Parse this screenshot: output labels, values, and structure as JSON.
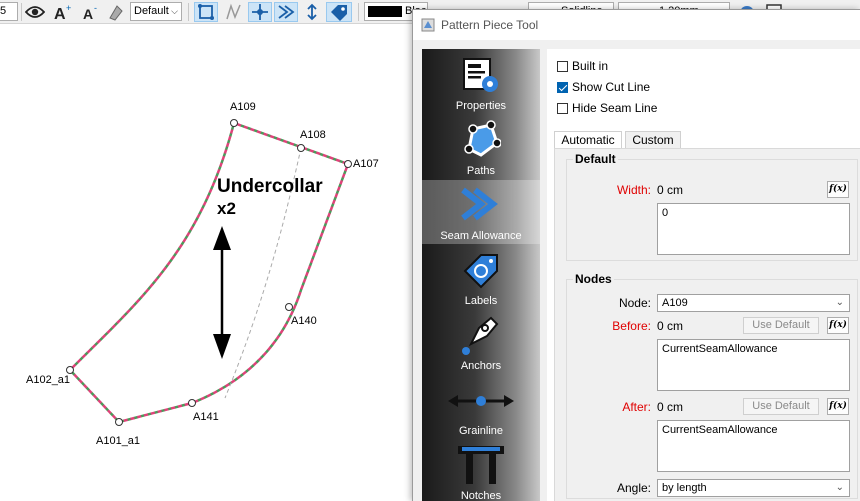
{
  "toolbar": {
    "size_value": "5",
    "line_type_value": "Default",
    "color_value": "Black",
    "pen_style_value": "Solidline",
    "line_weight_value": "1.20mm"
  },
  "canvas": {
    "piece_title": "Undercollar",
    "piece_count": "x2",
    "point_labels": [
      "A109",
      "A108",
      "A107",
      "A140",
      "A102_a1",
      "A141",
      "A101_a1"
    ],
    "seam_color": "#e0427a",
    "cut_color": "#4a9a5a"
  },
  "dialog": {
    "title": "Pattern Piece Tool",
    "nav": [
      "Properties",
      "Paths",
      "Seam Allowance",
      "Labels",
      "Anchors",
      "Grainline",
      "Notches"
    ],
    "selected_nav": "Seam Allowance",
    "checkboxes": [
      {
        "label": "Built in",
        "checked": false
      },
      {
        "label": "Show Cut Line",
        "checked": true
      },
      {
        "label": "Hide Seam Line",
        "checked": false
      }
    ],
    "tabs": [
      "Automatic",
      "Custom"
    ],
    "active_tab": "Automatic",
    "default_group": {
      "title": "Default",
      "width_label": "Width:",
      "width_value": "0 cm",
      "formula": "0"
    },
    "nodes_group": {
      "title": "Nodes",
      "node_label": "Node:",
      "node_value": "A109",
      "before_label": "Before:",
      "before_value": "0 cm",
      "before_formula": "CurrentSeamAllowance",
      "after_label": "After:",
      "after_value": "0 cm",
      "after_formula": "CurrentSeamAllowance",
      "angle_label": "Angle:",
      "angle_value": "by length",
      "use_default_label": "Use Default",
      "fx_label": "f(x)"
    }
  }
}
